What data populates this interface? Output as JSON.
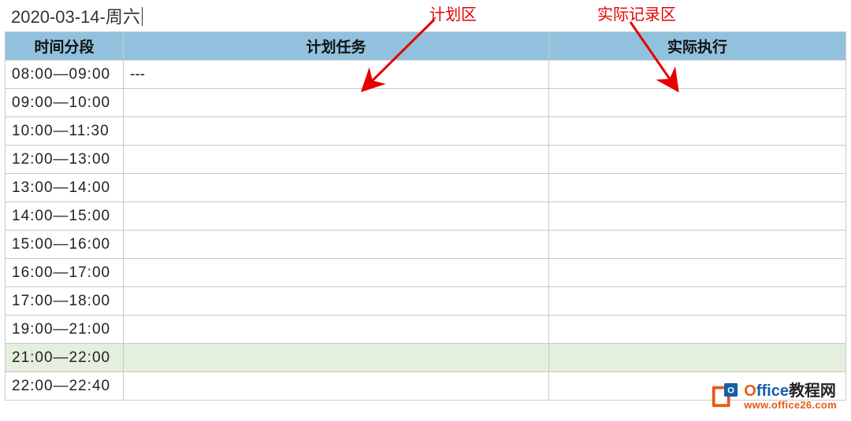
{
  "title": "2020-03-14-周六",
  "annotations": {
    "plan_label": "计划区",
    "actual_label": "实际记录区"
  },
  "columns": {
    "time": "时间分段",
    "plan": "计划任务",
    "actual": "实际执行"
  },
  "rows": [
    {
      "time": "08:00—09:00",
      "plan": "---",
      "actual": "",
      "highlight": false
    },
    {
      "time": "09:00—10:00",
      "plan": "",
      "actual": "",
      "highlight": false
    },
    {
      "time": "10:00—11:30",
      "plan": "",
      "actual": "",
      "highlight": false
    },
    {
      "time": "12:00—13:00",
      "plan": "",
      "actual": "",
      "highlight": false
    },
    {
      "time": "13:00—14:00",
      "plan": "",
      "actual": "",
      "highlight": false
    },
    {
      "time": "14:00—15:00",
      "plan": "",
      "actual": "",
      "highlight": false
    },
    {
      "time": "15:00—16:00",
      "plan": "",
      "actual": "",
      "highlight": false
    },
    {
      "time": "16:00—17:00",
      "plan": "",
      "actual": "",
      "highlight": false
    },
    {
      "time": "17:00—18:00",
      "plan": "",
      "actual": "",
      "highlight": false
    },
    {
      "time": "19:00—21:00",
      "plan": "",
      "actual": "",
      "highlight": false
    },
    {
      "time": "21:00—22:00",
      "plan": "",
      "actual": "",
      "highlight": true
    },
    {
      "time": "22:00—22:40",
      "plan": "",
      "actual": "",
      "highlight": false
    }
  ],
  "watermark": {
    "brand_head": "O",
    "brand_rest": "ffice",
    "brand_cn": "教程网",
    "url": "www.office26.com"
  }
}
